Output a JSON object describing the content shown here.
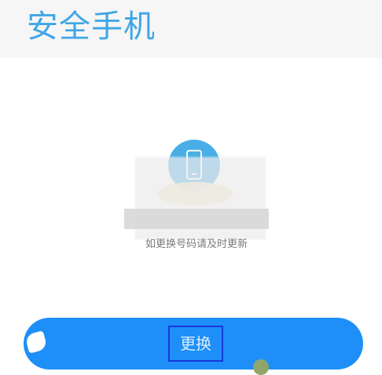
{
  "header": {
    "title": "安全手机"
  },
  "main": {
    "phone_number": "",
    "hint": "如更换号码请及时更新"
  },
  "button": {
    "change_label": "更换"
  },
  "colors": {
    "accent": "#3fa6e6",
    "button": "#1e8ff8",
    "hint": "#7b7b7b"
  }
}
